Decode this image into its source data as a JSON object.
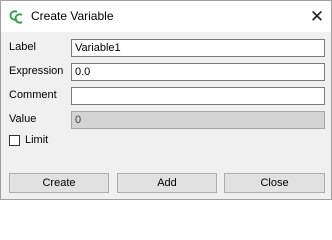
{
  "window": {
    "title": "Create Variable",
    "app_icon": "app-logo-icon",
    "close_icon": "close-icon",
    "close_glyph": "✕"
  },
  "form": {
    "label": {
      "caption": "Label",
      "value": "Variable1"
    },
    "expression": {
      "caption": "Expression",
      "value": "0.0"
    },
    "comment": {
      "caption": "Comment",
      "value": ""
    },
    "value": {
      "caption": "Value",
      "value": "0"
    },
    "limit": {
      "caption": "Limit",
      "checked": false
    }
  },
  "buttons": {
    "create": "Create",
    "add": "Add",
    "close": "Close"
  },
  "colors": {
    "logo": "#3aa04a",
    "dialog_bg": "#f0f0f0",
    "readonly_bg": "#d4d4d4"
  }
}
